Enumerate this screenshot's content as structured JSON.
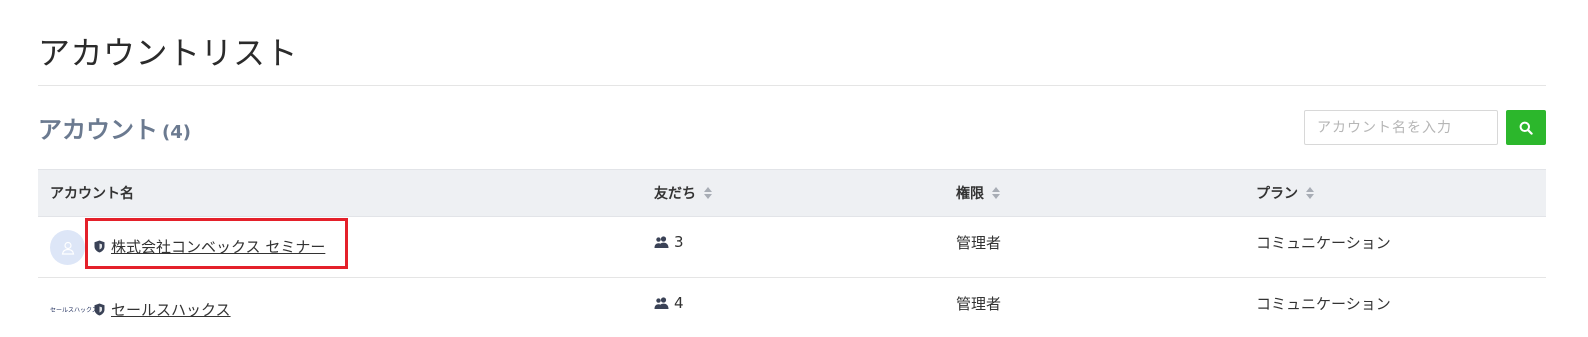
{
  "page": {
    "title": "アカウントリスト"
  },
  "section": {
    "title": "アカウント",
    "count": "(4)"
  },
  "search": {
    "placeholder": "アカウント名を入力",
    "button_icon": "search-icon"
  },
  "table": {
    "headers": {
      "account_name": "アカウント名",
      "friends": "友だち",
      "permission": "権限",
      "plan": "プラン"
    },
    "rows": [
      {
        "avatar": "default-user-avatar",
        "name": "株式会社コンベックス セミナー",
        "friends": "3",
        "permission": "管理者",
        "plan": "コミュニケーション",
        "highlighted": true
      },
      {
        "avatar_text": "セールスハックス",
        "name": "セールスハックス",
        "friends": "4",
        "permission": "管理者",
        "plan": "コミュニケーション",
        "highlighted": false
      }
    ]
  },
  "colors": {
    "accent_green": "#2cb72c",
    "highlight_red": "#e4202a",
    "header_bg": "#eef0f3",
    "section_title": "#6b7a90"
  }
}
